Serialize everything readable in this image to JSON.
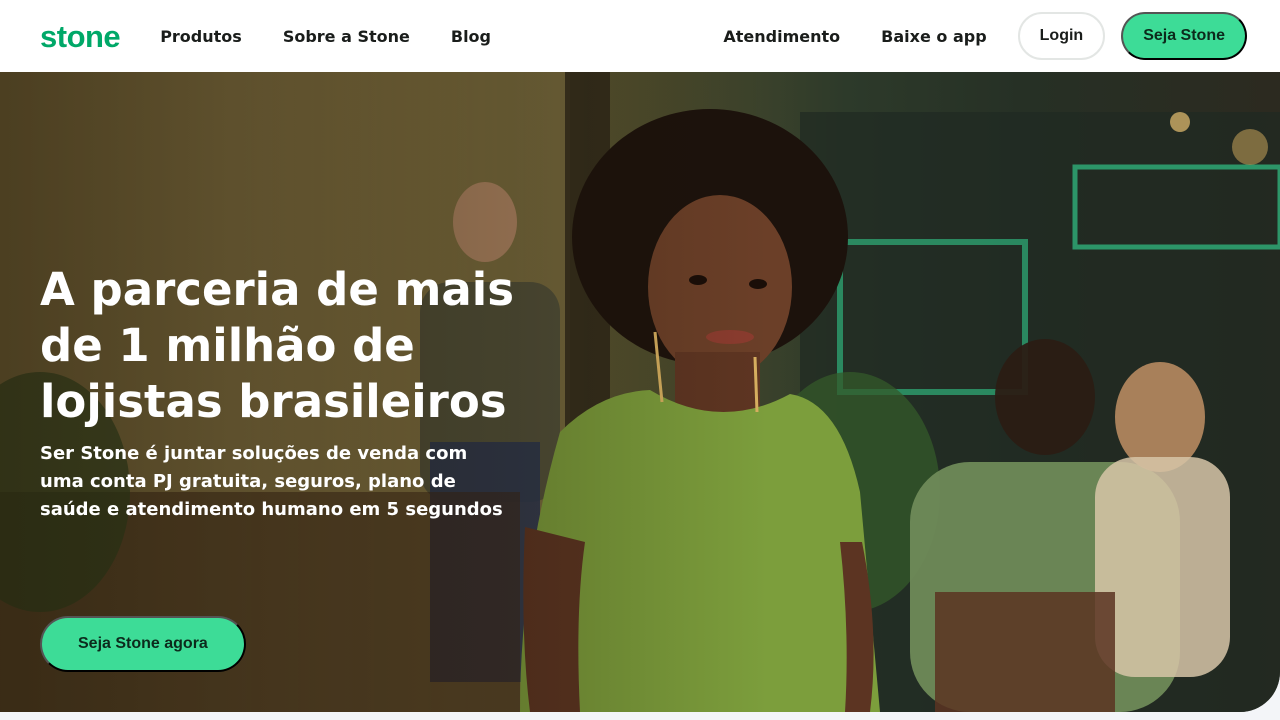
{
  "nav": {
    "logo": "stone",
    "links_left": [
      "Produtos",
      "Sobre a Stone",
      "Blog"
    ],
    "links_right": [
      "Atendimento",
      "Baixe o app"
    ],
    "login_label": "Login",
    "cta_label": "Seja Stone"
  },
  "hero": {
    "title": "A parceria de mais de 1 milhão de lojistas brasileiros",
    "subtitle": "Ser Stone é juntar soluções de venda com uma conta PJ gratuita, seguros, plano de saúde e atendimento humano em 5 segundos",
    "cta_label": "Seja Stone agora"
  },
  "colors": {
    "brand_green": "#00a868",
    "cta_green": "#3ddc97"
  }
}
